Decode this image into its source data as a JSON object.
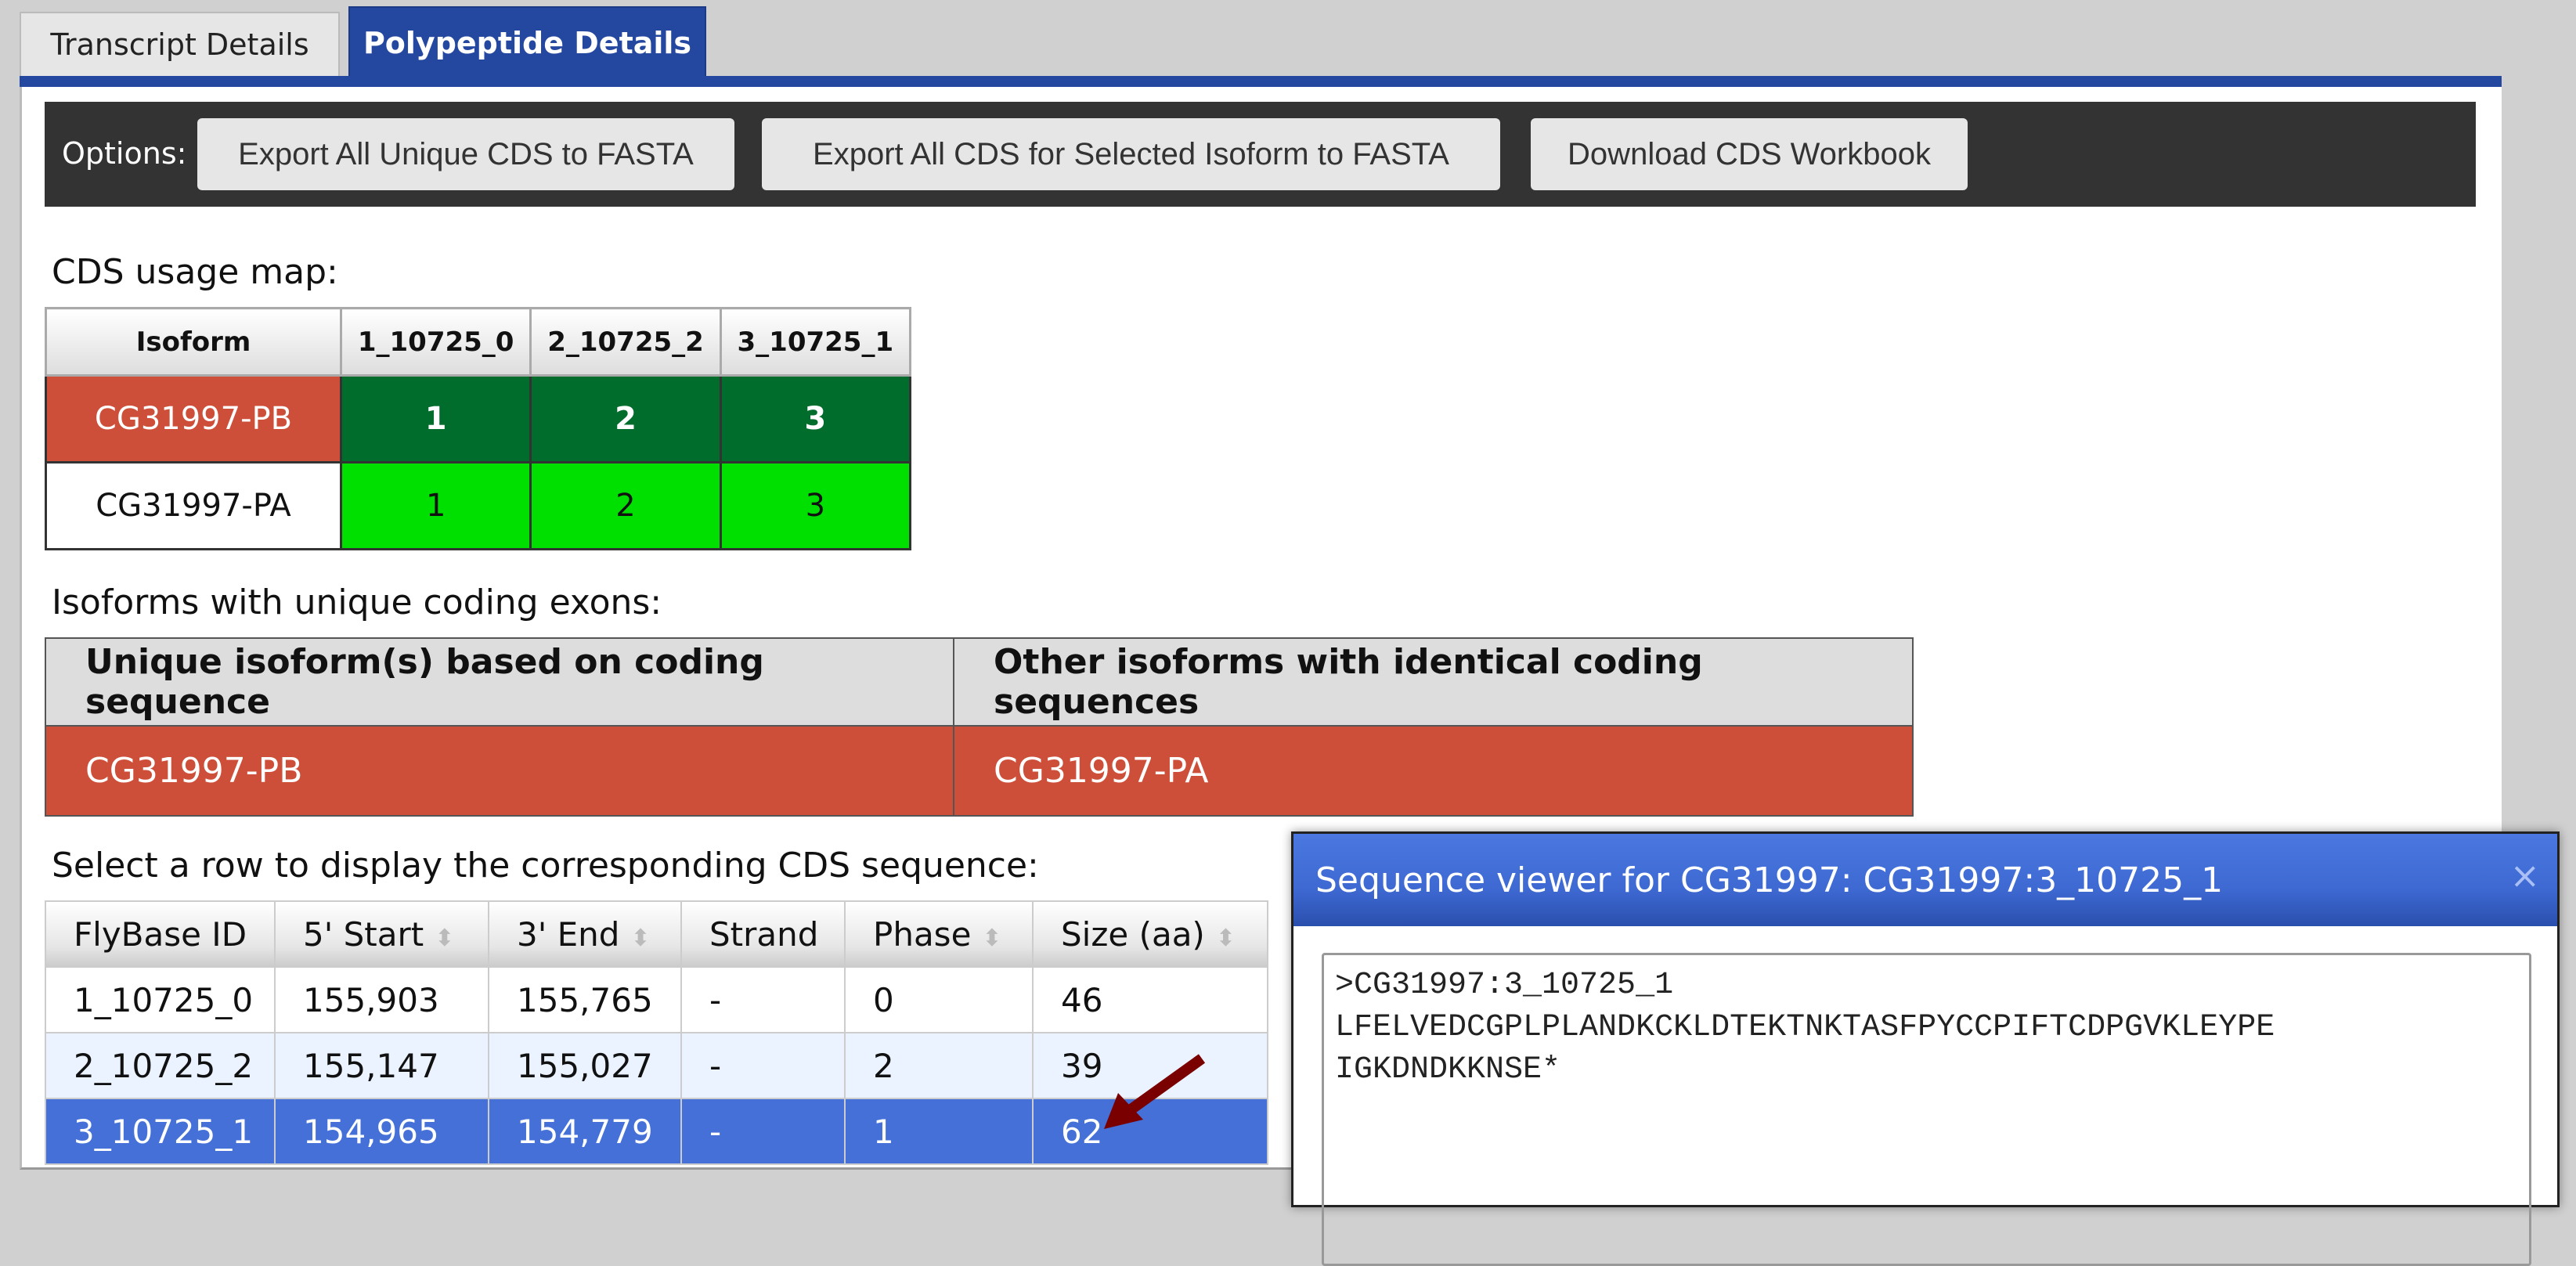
{
  "tabs": [
    {
      "label": "Transcript Details"
    },
    {
      "label": "Polypeptide Details",
      "active": true
    }
  ],
  "options": {
    "label": "Options:",
    "buttons": [
      "Export All Unique CDS to FASTA",
      "Export All CDS for Selected Isoform to FASTA",
      "Download CDS Workbook"
    ]
  },
  "usage_map": {
    "heading": "CDS usage map:",
    "headers": [
      "Isoform",
      "1_10725_0",
      "2_10725_2",
      "3_10725_1"
    ],
    "rows": [
      {
        "isoform": "CG31997-PB",
        "values": [
          "1",
          "2",
          "3"
        ]
      },
      {
        "isoform": "CG31997-PA",
        "values": [
          "1",
          "2",
          "3"
        ]
      }
    ]
  },
  "unique": {
    "heading": "Isoforms with unique coding exons:",
    "headers": [
      "Unique isoform(s) based on coding sequence",
      "Other isoforms with identical coding sequences"
    ],
    "row": [
      "CG31997-PB",
      "CG31997-PA"
    ]
  },
  "cds": {
    "heading": "Select a row to display the corresponding CDS sequence:",
    "headers": [
      "FlyBase ID",
      "5' Start",
      "3' End",
      "Strand",
      "Phase",
      "Size (aa)"
    ],
    "rows": [
      [
        "1_10725_0",
        "155,903",
        "155,765",
        "-",
        "0",
        "46"
      ],
      [
        "2_10725_2",
        "155,147",
        "155,027",
        "-",
        "2",
        "39"
      ],
      [
        "3_10725_1",
        "154,965",
        "154,779",
        "-",
        "1",
        "62"
      ]
    ],
    "selected_row": 2
  },
  "viewer": {
    "title": "Sequence viewer for CG31997: CG31997:3_10725_1",
    "close": "×",
    "sequence": ">CG31997:3_10725_1\nLFELVEDCGPLPLANDKCKLDTEKTNKTASFPYCCPIFTCDPGVKLEYPE\nIGKDNDKKNSE*"
  },
  "colors": {
    "tab_active": "#24479f",
    "selected_isoform": "#cd4f39",
    "cds_used_selected": "#006d2c",
    "cds_used": "#00e000",
    "selected_row": "#4470d8",
    "arrow": "#7a0000"
  }
}
